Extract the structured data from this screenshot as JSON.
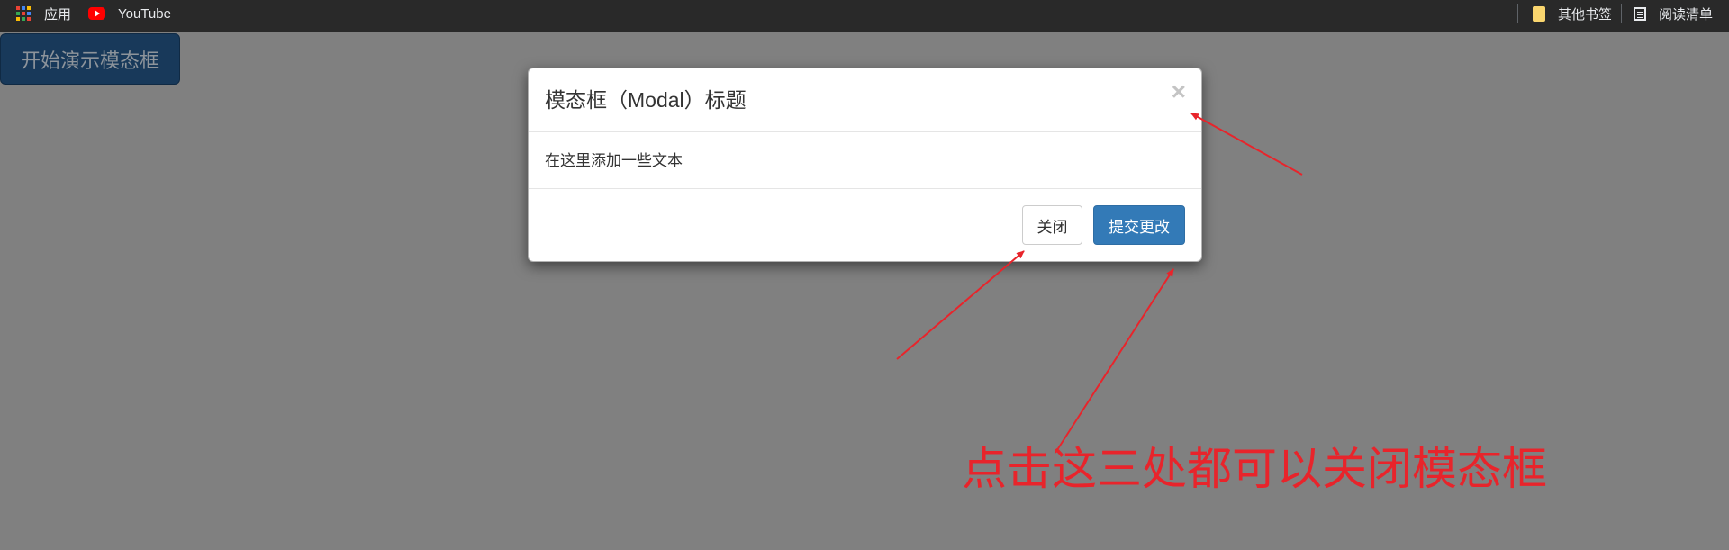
{
  "bookmarks_bar": {
    "apps_label": "应用",
    "youtube_label": "YouTube",
    "other_bookmarks_label": "其他书签",
    "reading_list_label": "阅读清单",
    "icons": [
      "apps-grid-icon",
      "youtube-icon",
      "folder-icon",
      "reading-list-icon"
    ],
    "apps_colors": [
      "#ea4335",
      "#4285f4",
      "#fbbc05",
      "#34a853",
      "#ea4335",
      "#4285f4",
      "#fbbc05",
      "#34a853",
      "#ea4335"
    ]
  },
  "page": {
    "start_button_label": "开始演示模态框"
  },
  "modal": {
    "title": "模态框（Modal）标题",
    "close_symbol": "×",
    "body_text": "在这里添加一些文本",
    "close_button_label": "关闭",
    "submit_button_label": "提交更改"
  },
  "annotation": {
    "text": "点击这三处都可以关闭模态框",
    "color": "#e8242b"
  },
  "colors": {
    "backdrop": "#808080",
    "bookmarks_bar": "#292929",
    "primary": "#337ab7"
  }
}
